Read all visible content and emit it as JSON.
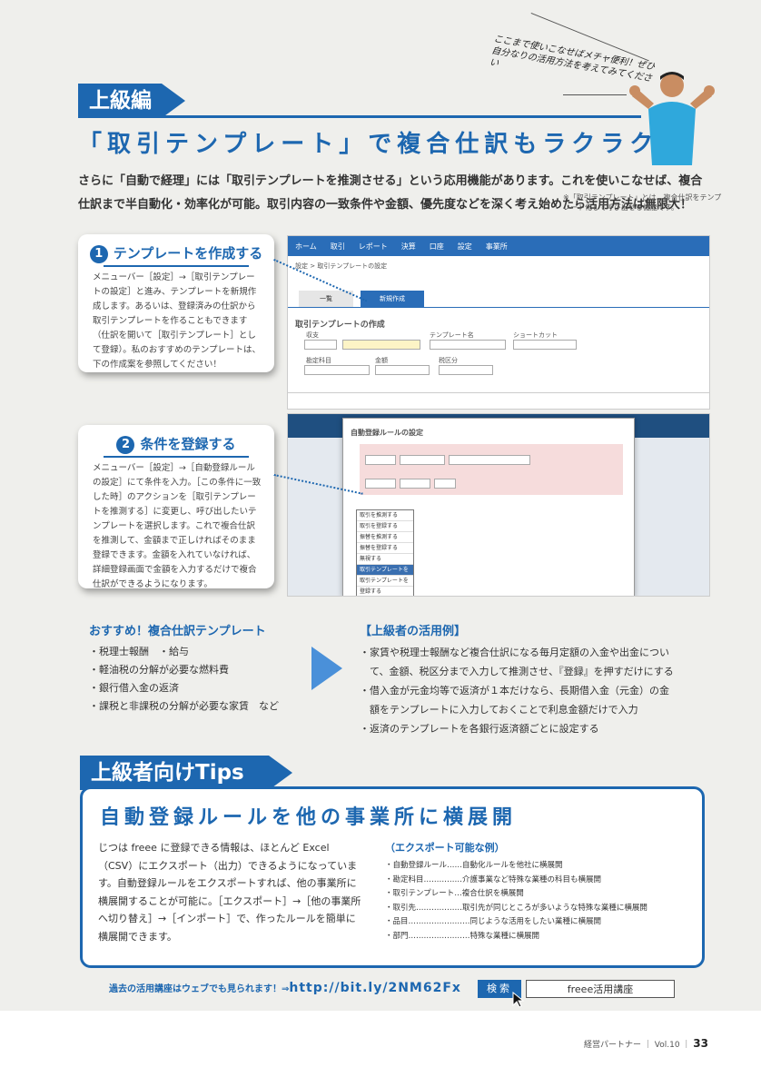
{
  "section_tag": "上級編",
  "headline": "「取引テンプレート」で複合仕訳もラクラク",
  "intro": "さらに「自動で経理」には「取引テンプレートを推測させる」という応用機能があります。これを使いこなせば、複合仕訳まで半自動化・効率化が可能。取引内容の一致条件や金額、優先度などを深く考え始めたら活用方法は無限大！",
  "note": "※「取引テンプレート」とは、複合仕訳をテンプレート化して呼び出せる機能です。",
  "speech": "ここまで使いこなせばメチャ便利！ぜひ自分なりの活用方法を考えてみてください",
  "step1": {
    "num": "1",
    "title": "テンプレートを作成する",
    "body": "メニューバー［設定］→［取引テンプレートの設定］と進み、テンプレートを新規作成します。あるいは、登録済みの仕訳から取引テンプレートを作ることもできます（仕訳を開いて［取引テンプレート］として登録）。私のおすすめのテンプレートは、下の作成案を参照してください！"
  },
  "step2": {
    "num": "2",
    "title": "条件を登録する",
    "body": "メニューバー［設定］→［自動登録ルールの設定］にて条件を入力。［この条件に一致した時］のアクションを［取引テンプレートを推測する］に変更し、呼び出したいテンプレートを選択します。これで複合仕訳を推測して、金額まで正しければそのまま登録できます。金額を入れていなければ、詳細登録画面で金額を入力するだけで複合仕訳ができるようになります。"
  },
  "shot1": {
    "nav": [
      "ホーム",
      "取引",
      "レポート",
      "決算",
      "口座",
      "設定",
      "事業所"
    ],
    "breadcrumb": "設定 > 取引テンプレートの設定",
    "tabs": [
      "一覧",
      "新規作成"
    ],
    "form_title": "取引テンプレートの作成",
    "fields": [
      "収支",
      "テンプレート名",
      "ショートカット",
      "勘定科目",
      "金額",
      "税区分"
    ]
  },
  "shot2": {
    "modal_title": "自動登録ルールの設定",
    "dropdown": [
      "取引を推測する",
      "取引を登録する",
      "振替を推測する",
      "振替を登録する",
      "無視する",
      "取引テンプレートを推測する",
      "取引テンプレートを登録する"
    ]
  },
  "recommend": {
    "title": "おすすめ！複合仕訳テンプレート",
    "items": [
      "・税理士報酬　・給与",
      "・軽油税の分解が必要な燃料費",
      "・銀行借入金の返済",
      "・課税と非課税の分解が必要な家賃　など"
    ]
  },
  "advanced": {
    "title": "【上級者の活用例】",
    "items": [
      "・家賃や税理士報酬など複合仕訳になる毎月定額の入金や出金につい",
      "　て、金額、税区分まで入力して推測させ、『登録』を押すだけにする",
      "・借入金が元金均等で返済が１本だけなら、長期借入金（元金）の金",
      "　額をテンプレートに入力しておくことで利息金額だけで入力",
      "・返済のテンプレートを各銀行返済額ごとに設定する"
    ]
  },
  "tips": {
    "tag": "上級者向けTips",
    "headline": "自動登録ルールを他の事業所に横展開",
    "body": "じつは freee に登録できる情報は、ほとんど Excel（CSV）にエクスポート（出力）できるようになっています。自動登録ルールをエクスポートすれば、他の事業所に横展開することが可能に。［エクスポート］→［他の事業所へ切り替え］→［インポート］で、作ったルールを簡単に横展開できます。",
    "examples_title": "（エクスポート可能な例）",
    "examples": [
      "・自動登録ルール……自動化ルールを他社に横展開",
      "・勘定科目……………介護事業など特殊な業種の科目も横展開",
      "・取引テンプレート…複合仕訳を横展開",
      "・取引先………………取引先が同じところが多いような特殊な業種に横展開",
      "・品目……………………同じような活用をしたい業種に横展開",
      "・部門……………………特殊な業種に横展開"
    ]
  },
  "promo": {
    "text": "過去の活用講座はウェブでも見られます！⇒",
    "url": "http://bit.ly/2NM62Fx",
    "button": "検索",
    "field": "freee活用講座"
  },
  "footer": {
    "magazine": "経営パートナー",
    "vol": "Vol.10",
    "page": "33"
  },
  "colors": {
    "accent": "#1d67b0",
    "arrow": "#4a90d9",
    "bg": "#efefec"
  }
}
